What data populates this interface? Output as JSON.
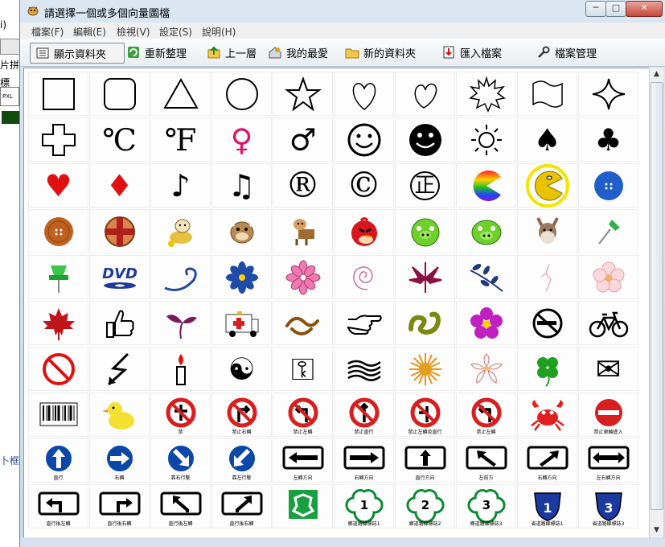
{
  "background_app": {
    "fragments": [
      "i)",
      "片拼",
      "標",
      "PXL",
      "卜框"
    ]
  },
  "window": {
    "title": "請選擇一個或多個向量圖檔",
    "controls": {
      "minimize": "─",
      "maximize": "□",
      "close": "✕"
    }
  },
  "menu": [
    "檔案(F)",
    "編輯(E)",
    "檢視(V)",
    "設定(S)",
    "說明(H)"
  ],
  "toolbar": {
    "show_folder": "顯示資料夾",
    "refresh": "重新整理",
    "up": "上一層",
    "favorites": "我的最愛",
    "new_folder": "新的資料夾",
    "import": "匯入檔案",
    "manage": "檔案管理"
  },
  "grid": {
    "rows": [
      [
        "square",
        "rounded-square",
        "triangle",
        "circle",
        "star",
        "heart",
        "heart-tilted",
        "starburst",
        "flag",
        "four-point-star"
      ],
      [
        "cross",
        "celsius",
        "fahrenheit",
        "female",
        "male",
        "smiley",
        "black-smiley",
        "sun",
        "spade",
        "club"
      ],
      [
        "red-heart",
        "red-diamond",
        "eighth-note",
        "beamed-notes",
        "registered",
        "copyright",
        "zheng-seal",
        "rainbow-pacman",
        "pacman",
        "blue-button"
      ],
      [
        "orange-button",
        "patterned-button",
        "cow-coins",
        "cow",
        "cow-sign",
        "angry-bird-red",
        "green-pig",
        "green-pig-2",
        "donkey",
        "green-pushpin"
      ],
      [
        "pushpin",
        "dvd-logo",
        "swirl",
        "blue-flower",
        "pink-flower",
        "spiral",
        "maroon-leaf",
        "branch-leaves",
        "crack",
        "sakura"
      ],
      [
        "maple-leaf",
        "thumbs-up",
        "sprout",
        "ambulance",
        "ornament-swirl",
        "pointing-hand",
        "green-ornament",
        "purple-flower",
        "no-smoking",
        "bicycle"
      ],
      [
        "prohibition",
        "lightning-arrow",
        "candle",
        "yin-yang",
        "key",
        "waves",
        "sunflower",
        "white-flower",
        "four-leaf-clover",
        "envelope"
      ],
      [
        "barcode",
        "yellow-duck",
        "no-entry-sign",
        "no-right-turn",
        "no-left-turn",
        "no-straight",
        "no-left-straight",
        "no-u-turn",
        "red-crab",
        "do-not-enter"
      ],
      [
        "straight-arrow-sign",
        "right-arrow-sign",
        "diagonal-sign",
        "diagonal-left-sign",
        "left-direction-sign",
        "right-direction-sign",
        "up-direction-sign",
        "left-diag-sign",
        "right-diag-sign",
        "both-way-sign"
      ],
      [
        "turn-left-sign",
        "turn-right-sign",
        "left-diag-turn",
        "right-diag-turn",
        "recycle-box",
        "route-1",
        "route-2",
        "route-3",
        "highway-1",
        "highway-3"
      ]
    ],
    "text_glyphs": {
      "celsius": "℃",
      "fahrenheit": "℉",
      "female": "♀",
      "male": "♂",
      "spade": "♠",
      "club": "♣",
      "red-heart": "♥",
      "red-diamond": "♦",
      "eighth-note": "♪",
      "beamed-notes": "♫",
      "registered": "®",
      "copyright": "©",
      "zheng-seal": "正",
      "yin-yang": "☯",
      "key": "⚿",
      "envelope": "✉"
    },
    "sign_captions": {
      "straight-arrow-sign": "直行",
      "right-arrow-sign": "右轉",
      "diagonal-sign": "靠右行駛",
      "diagonal-left-sign": "靠左行駛",
      "left-direction-sign": "左轉方向",
      "right-direction-sign": "右轉方向",
      "up-direction-sign": "直行方向",
      "left-diag-sign": "左前方",
      "right-diag-sign": "右轉方向",
      "both-way-sign": "左右轉方向",
      "turn-left-sign": "直行後左轉",
      "turn-right-sign": "直行後右轉",
      "left-diag-turn": "直行後左轉",
      "right-diag-turn": "直行後右轉",
      "route-1": "鄉道路線標誌1",
      "route-2": "鄉道路線標誌2",
      "route-3": "鄉道路線標誌3",
      "highway-1": "省道路線標誌1",
      "highway-3": "省道路線標誌3",
      "no-entry-sign": "禁",
      "no-right-turn": "禁止右轉",
      "no-left-turn": "禁止左轉",
      "no-straight": "禁止直行",
      "no-left-straight": "禁止左轉及直行",
      "no-u-turn": "禁止左轉",
      "do-not-enter": "禁止車輛進入"
    },
    "route_numbers": {
      "route-1": "1",
      "route-2": "2",
      "route-3": "3",
      "highway-1": "1",
      "highway-3": "3"
    },
    "highlighted": "pacman"
  },
  "colors": {
    "highlight_ring": "#f2e600",
    "sign_blue": "#0b47a6",
    "sign_red": "#d81e1e",
    "route_green": "#0a8a30"
  }
}
